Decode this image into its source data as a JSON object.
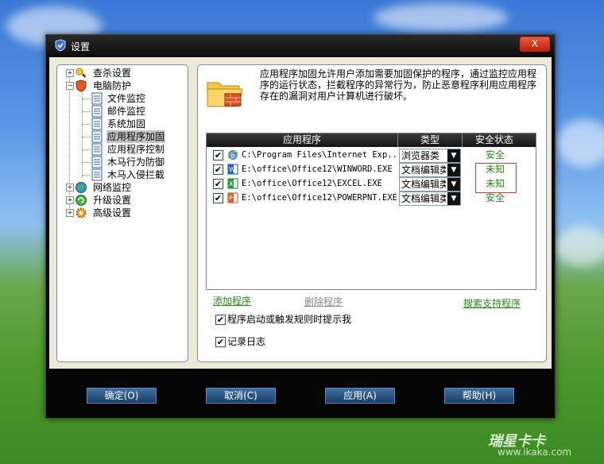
{
  "window": {
    "title": "设置",
    "close_label": "X"
  },
  "tree": {
    "items": [
      {
        "label": "查杀设置"
      },
      {
        "label": "电脑防护"
      },
      {
        "label": "文件监控"
      },
      {
        "label": "邮件监控"
      },
      {
        "label": "系统加固"
      },
      {
        "label": "应用程序加固"
      },
      {
        "label": "应用程序控制"
      },
      {
        "label": "木马行为防御"
      },
      {
        "label": "木马入侵拦截"
      },
      {
        "label": "网络监控"
      },
      {
        "label": "升级设置"
      },
      {
        "label": "高级设置"
      }
    ]
  },
  "main": {
    "description": "应用程序加固允许用户添加需要加固保护的程序，通过监控应用程序的运行状态，拦截程序的异常行为，防止恶意程序利用应用程序存在的漏洞对用户计算机进行破坏。",
    "table": {
      "headers": {
        "app": "应用程序",
        "type": "类型",
        "status": "安全状态"
      },
      "rows": [
        {
          "checked": "✔",
          "path": "C:\\Program Files\\Internet Exp...",
          "type": "浏览器类",
          "status": "安全"
        },
        {
          "checked": "✔",
          "path": "E:\\office\\Office12\\WINWORD.EXE",
          "type": "文档编辑类",
          "status": "未知"
        },
        {
          "checked": "✔",
          "path": "E:\\office\\Office12\\EXCEL.EXE",
          "type": "文档编辑类",
          "status": "未知"
        },
        {
          "checked": "✔",
          "path": "E:\\office\\Office12\\POWERPNT.EXE",
          "type": "文档编辑类",
          "status": "安全"
        }
      ]
    },
    "links": {
      "add": "添加程序",
      "remove": "删除程序",
      "search": "搜索支持程序"
    },
    "options": {
      "notify_label": "程序启动或触发规则时提示我",
      "log_label": "记录日志",
      "check": "✔"
    }
  },
  "footer": {
    "ok": "确定(O)",
    "cancel": "取消(C)",
    "apply": "应用(A)",
    "help": "帮助(H)"
  },
  "watermark": {
    "brand": "瑞星卡卡",
    "url": "www.ikaka.com"
  },
  "colors": {
    "safe": "#2a8a1a",
    "unknown": "#2a8a1a",
    "link": "#2a8a1a",
    "link_disabled": "#8a8a8a",
    "button_top": "#3f6e9e",
    "button_bottom": "#1a3f69"
  }
}
